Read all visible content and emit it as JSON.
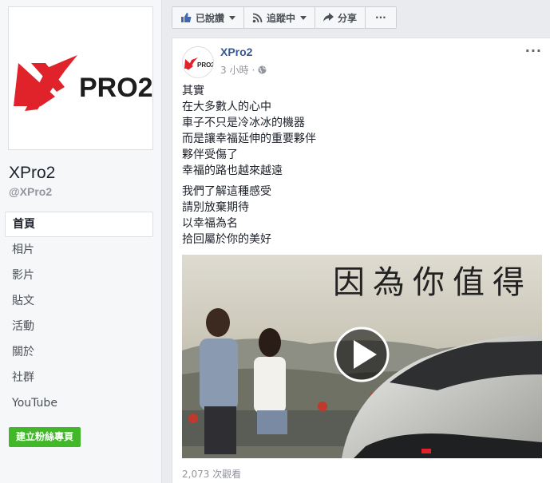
{
  "page": {
    "name": "XPro2",
    "handle": "@XPro2",
    "logo_text": "PRO2"
  },
  "nav": {
    "items": [
      {
        "label": "首頁",
        "active": true
      },
      {
        "label": "相片"
      },
      {
        "label": "影片"
      },
      {
        "label": "貼文"
      },
      {
        "label": "活動"
      },
      {
        "label": "關於"
      },
      {
        "label": "社群"
      },
      {
        "label": "YouTube"
      }
    ],
    "create_page_label": "建立粉絲專頁"
  },
  "actionbar": {
    "liked_label": "已說讚",
    "following_label": "追蹤中",
    "share_label": "分享",
    "more_label": "···"
  },
  "post": {
    "author": "XPro2",
    "time": "3 小時",
    "separator": "·",
    "more_label": "···",
    "paragraph1": [
      "其實",
      "在大多數人的心中",
      "車子不只是冷冰冰的機器",
      "而是讓幸福延伸的重要夥伴",
      "夥伴受傷了",
      "幸福的路也越來越遠"
    ],
    "paragraph2": [
      "我們了解這種感受",
      "請別放棄期待",
      "以幸福為名",
      "拾回屬於你的美好"
    ],
    "video_caption": "因為你值得",
    "views": "2,073 次觀看"
  },
  "colors": {
    "brand_red": "#e0232b",
    "link_blue": "#365899",
    "green": "#42b72a"
  }
}
